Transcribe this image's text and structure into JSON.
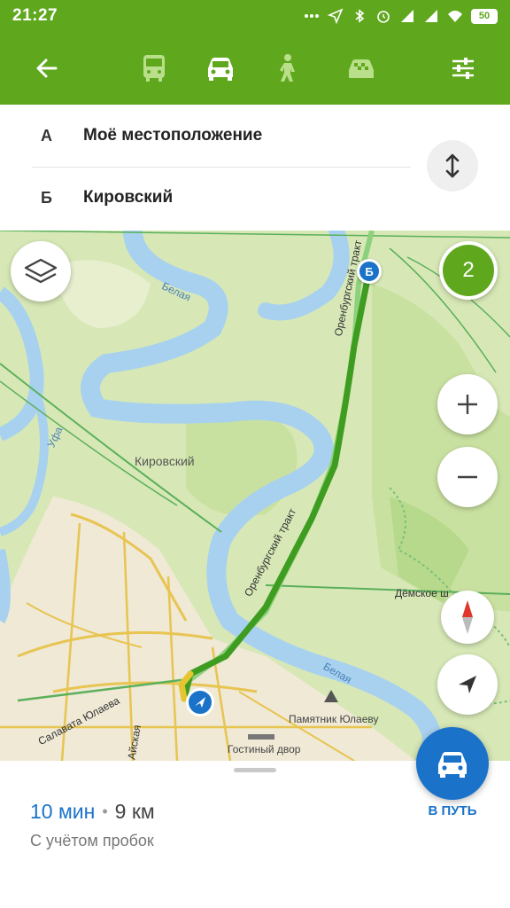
{
  "status_bar": {
    "time": "21:27",
    "battery": "50"
  },
  "toolbar": {
    "icons": [
      "back-arrow-icon",
      "bus-icon",
      "car-icon",
      "pedestrian-icon",
      "taxi-icon",
      "settings-sliders-icon"
    ],
    "accent_color": "#5fa81e"
  },
  "route": {
    "from": {
      "letter": "А",
      "place": "Моё местоположение"
    },
    "to": {
      "letter": "Б",
      "place": "Кировский"
    }
  },
  "map": {
    "labels": {
      "river_top": "Белая",
      "river_ufa": "Уфа",
      "district": "Кировский",
      "tract_top": "Оренбургский тракт",
      "tract_mid": "Оренбургский тракт",
      "street_demskoe": "Дёмское ш",
      "river_bottom": "Белая",
      "monument": "Памятник Юлаеву",
      "gostiny": "Гостиный двор",
      "salavat": "Салавата Юлаева",
      "street_aiskaya": "Айская"
    },
    "route_alternatives": "2",
    "destination_marker": "Б"
  },
  "summary": {
    "time": "10 мин",
    "distance": "9 км",
    "subtitle": "С учётом пробок",
    "go_label": "В ПУТЬ"
  }
}
